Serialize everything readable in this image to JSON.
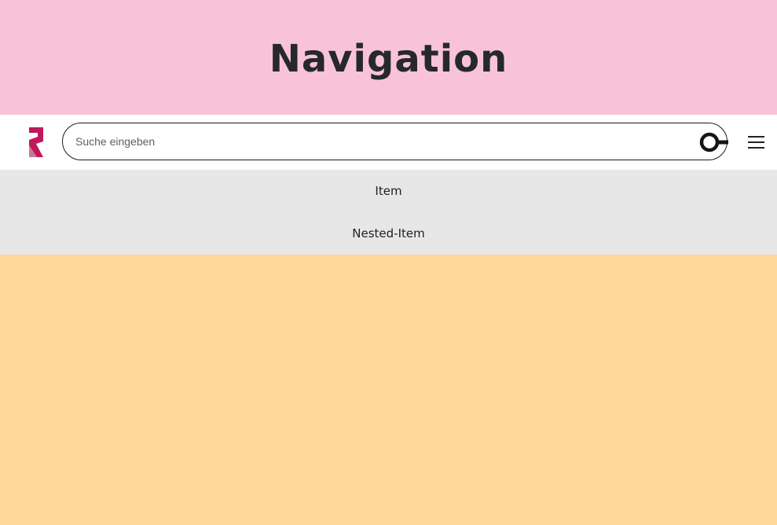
{
  "hero": {
    "title": "Navigation",
    "background": "#f8c3d9"
  },
  "header": {
    "logo_icon": "brand-r-logo-icon",
    "logo_color": "#c2185b",
    "search": {
      "placeholder": "Suche eingeben",
      "value": "",
      "icon": "search-key-icon"
    },
    "menu_icon": "hamburger-menu-icon"
  },
  "menu": {
    "background": "#e7e7e7",
    "items": [
      {
        "label": "Item"
      },
      {
        "label": "Nested-Item"
      }
    ]
  },
  "content": {
    "background": "#fed998"
  }
}
